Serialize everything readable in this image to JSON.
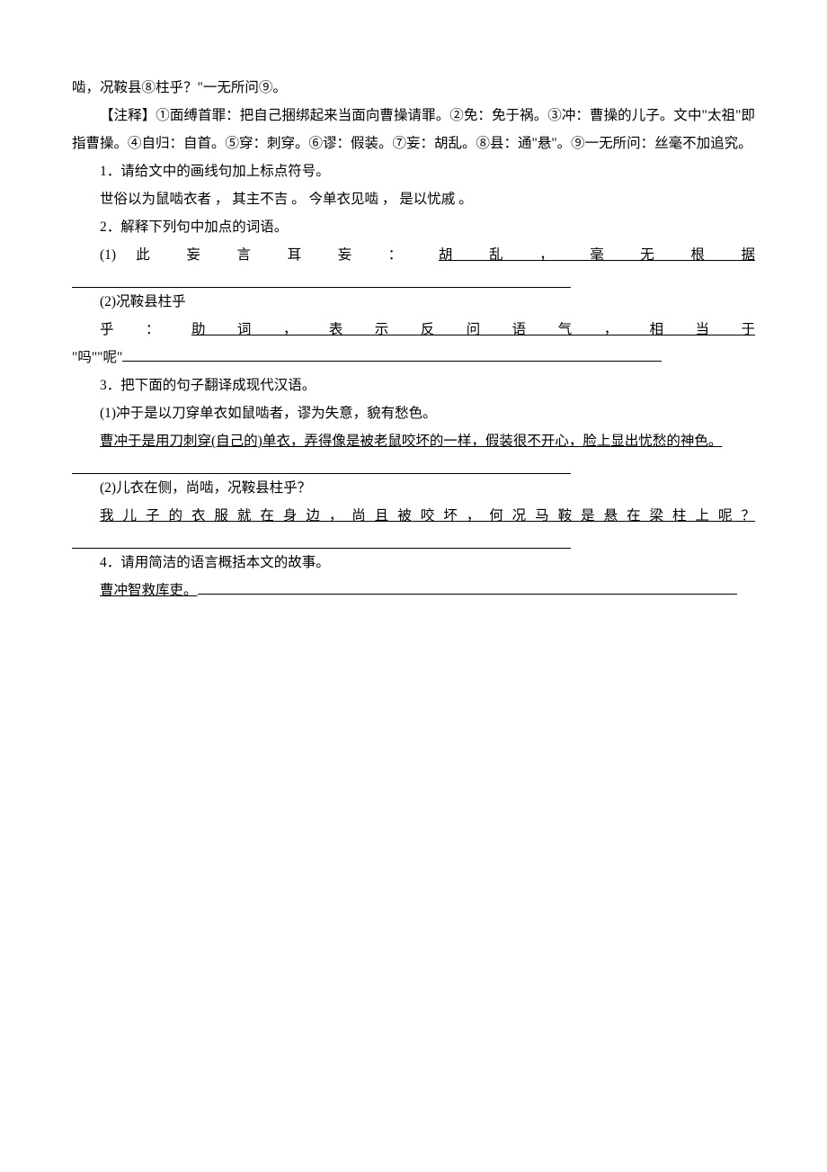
{
  "lines": {
    "l1": "啮，况鞍县⑧柱乎？\"一无所问⑨。",
    "l2": "【注释】①面缚首罪：把自己捆绑起来当面向曹操请罪。②免：免于祸。③冲：曹操的儿子。文中\"太祖\"即指曹操。④自归：自首。⑤穿：刺穿。⑥谬：假装。⑦妄：胡乱。⑧县：通\"悬\"。⑨一无所问：丝毫不加追究。"
  },
  "q1": {
    "prompt": "1．请给文中的画线句加上标点符号。",
    "answer": "世俗以为鼠啮衣者 ， 其主不吉 。 今单衣见啮 ， 是以忧戚 。"
  },
  "q2": {
    "prompt": "2．解释下列句中加点的词语。",
    "item1_prefix": "(1) 此 妄 言 耳    妄 ： ",
    "item1_answer": " 胡 乱 ， 毫 无 根 据 ",
    "item2_prefix": "(2)况鞍县柱乎",
    "item2_label": "乎 ： ",
    "item2_answer": " 助 词 ， 表 示 反 问 语 气 ， 相 当 于 ",
    "item2_tail": "\"吗\"\"呢\""
  },
  "q3": {
    "prompt": "3．把下面的句子翻译成现代汉语。",
    "item1_q": "(1)冲于是以刀穿单衣如鼠啮者，谬为失意，貌有愁色。",
    "item1_a": "曹冲于是用刀刺穿(自己的)单衣，弄得像是被老鼠咬坏的一样，假装很不开心，脸上显出忧愁的神色。",
    "item2_q": "(2)儿衣在侧，尚啮，况鞍县柱乎？",
    "item2_a": " 我 儿 子 的 衣 服 就 在 身 边 ， 尚 且 被 咬 坏 ， 何 况 马 鞍 是 悬 在 梁 柱 上 呢 ？ "
  },
  "q4": {
    "prompt": "4．请用简洁的语言概括本文的故事。",
    "answer": "曹冲智救库吏。"
  }
}
